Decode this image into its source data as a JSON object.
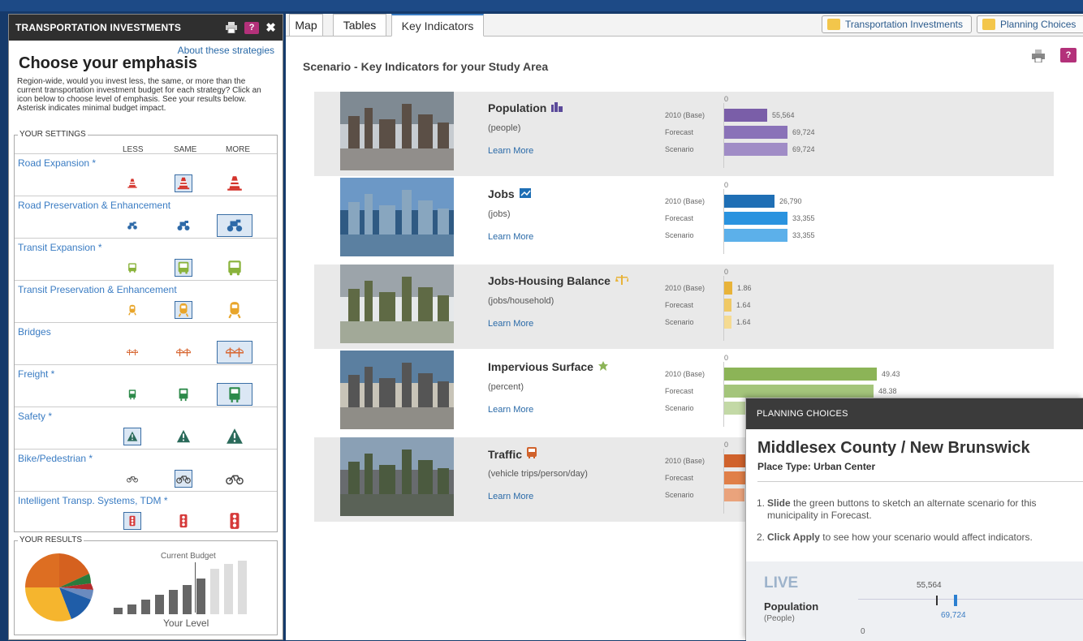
{
  "left_panel": {
    "header_title": "TRANSPORTATION INVESTMENTS",
    "help_label": "?",
    "about_link": "About these strategies",
    "heading": "Choose your emphasis",
    "description": "Region-wide, would you invest less, the same, or more than the current transportation investment budget for each strategy? Click an icon below to choose level of emphasis. See your results below. Asterisk indicates minimal budget impact.",
    "settings_label": "YOUR SETTINGS",
    "columns": [
      "LESS",
      "SAME",
      "MORE"
    ],
    "strategies": [
      {
        "name": "Road Expansion *",
        "icon": "traffic-cone-icon",
        "selected": "SAME"
      },
      {
        "name": "Road Preservation & Enhancement",
        "icon": "roller-icon",
        "selected": "MORE"
      },
      {
        "name": "Transit Expansion *",
        "icon": "bus-icon",
        "selected": "SAME"
      },
      {
        "name": "Transit Preservation & Enhancement",
        "icon": "train-icon",
        "selected": "SAME"
      },
      {
        "name": "Bridges",
        "icon": "bridge-icon",
        "selected": "MORE"
      },
      {
        "name": "Freight *",
        "icon": "truck-icon",
        "selected": "MORE"
      },
      {
        "name": "Safety *",
        "icon": "warning-triangle-icon",
        "selected": "LESS"
      },
      {
        "name": "Bike/Pedestrian *",
        "icon": "bicycle-icon",
        "selected": "SAME"
      },
      {
        "name": "Intelligent Transp. Systems, TDM *",
        "icon": "traffic-light-icon",
        "selected": "LESS"
      }
    ],
    "results_label": "YOUR RESULTS",
    "current_budget_label": "Current Budget",
    "your_level_label": "Your Level"
  },
  "tabs": [
    "Map",
    "Tables",
    "Key Indicators"
  ],
  "active_tab": "Key Indicators",
  "top_buttons": [
    "Transportation Investments",
    "Planning Choices"
  ],
  "section_title": "Scenario - Key Indicators for your Study Area",
  "bar_labels": [
    "2010 (Base)",
    "Forecast",
    "Scenario"
  ],
  "learn_more": "Learn More",
  "indicators": [
    {
      "title": "Population",
      "unit": "(people)",
      "icon": "people-icon",
      "zero": "0",
      "values": [
        "55,564",
        "69,724",
        "69,724"
      ],
      "colors": [
        "#7a5ea8",
        "#8a72b8",
        "#a08cc6"
      ]
    },
    {
      "title": "Jobs",
      "unit": "(jobs)",
      "icon": "chart-icon",
      "zero": "0",
      "values": [
        "26,790",
        "33,355",
        "33,355"
      ],
      "colors": [
        "#1f6fb5",
        "#2a93df",
        "#5cb0ea"
      ]
    },
    {
      "title": "Jobs-Housing Balance",
      "unit": "(jobs/household)",
      "icon": "balance-icon",
      "zero": "0",
      "values": [
        "1.86",
        "1.64",
        "1.64"
      ],
      "colors": [
        "#e8b339",
        "#f0c965",
        "#f5db92"
      ]
    },
    {
      "title": "Impervious Surface",
      "unit": "(percent)",
      "icon": "leaf-icon",
      "zero": "0",
      "values": [
        "49.43",
        "48.38",
        ""
      ],
      "colors": [
        "#8cb457",
        "#a4c57b",
        "#c3d9a6"
      ]
    },
    {
      "title": "Traffic",
      "unit": "(vehicle trips/person/day)",
      "icon": "bus-front-icon",
      "zero": "0",
      "values": [
        "",
        "",
        ""
      ],
      "colors": [
        "#d0622c",
        "#e07f48",
        "#eaa37c"
      ]
    }
  ],
  "planning": {
    "header": "PLANNING CHOICES",
    "title": "Middlesex County / New Brunswick",
    "place_type": "Place Type: Urban Center",
    "step1_bold": "Slide",
    "step1_rest": "the green buttons to sketch an alternate scenario for this municipality in Forecast.",
    "step2_bold": "Click Apply",
    "step2_rest": "to see how your scenario would affect indicators.",
    "live_label": "LIVE",
    "population_label": "Population",
    "people_label": "(People)",
    "base_value": "55,564",
    "forecast_value": "69,724",
    "zero_label": "0"
  }
}
